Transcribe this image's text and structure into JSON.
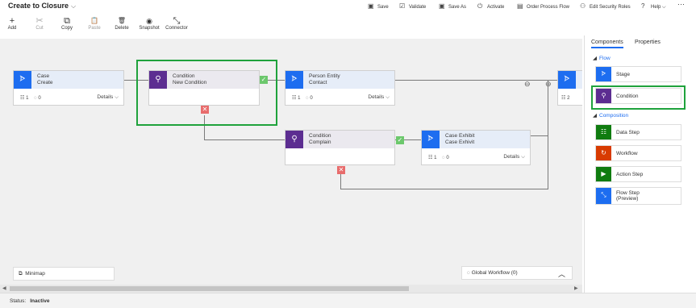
{
  "header": {
    "title": "Create to Closure"
  },
  "toolbar": [
    {
      "label": "Add",
      "icon": "plus-icon",
      "glyph": "+",
      "disabled": false
    },
    {
      "label": "Cut",
      "icon": "scissors-icon",
      "glyph": "✂",
      "disabled": true
    },
    {
      "label": "Copy",
      "icon": "copy-icon",
      "glyph": "⧉",
      "disabled": false
    },
    {
      "label": "Paste",
      "icon": "clipboard-icon",
      "glyph": "📋",
      "disabled": true
    },
    {
      "label": "Delete",
      "icon": "trash-icon",
      "glyph": "🗑",
      "disabled": false
    },
    {
      "label": "Snapshot",
      "icon": "camera-icon",
      "glyph": "◉",
      "disabled": false
    },
    {
      "label": "Connector",
      "icon": "connector-icon",
      "glyph": "⤡",
      "disabled": false
    }
  ],
  "commands": [
    {
      "label": "Save",
      "icon": "save-icon",
      "glyph": "💾"
    },
    {
      "label": "Validate",
      "icon": "validate-icon",
      "glyph": "☑"
    },
    {
      "label": "Save As",
      "icon": "save-as-icon",
      "glyph": "💾"
    },
    {
      "label": "Activate",
      "icon": "activate-icon",
      "glyph": "⏻"
    },
    {
      "label": "Order Process Flow",
      "icon": "order-icon",
      "glyph": "▤"
    },
    {
      "label": "Edit Security Roles",
      "icon": "security-icon",
      "glyph": "👥"
    },
    {
      "label": "Help",
      "icon": "help-icon",
      "glyph": "?"
    },
    {
      "label": "···",
      "icon": "more-icon",
      "glyph": ""
    }
  ],
  "nodes": [
    {
      "line1": "Case",
      "line2": "Create",
      "steps": "1",
      "workflows": "0",
      "details": "Details"
    },
    {
      "line1": "Condition",
      "line2": "New Condition"
    },
    {
      "line1": "Person Entity",
      "line2": "Contact",
      "steps": "1",
      "workflows": "0",
      "details": "Details"
    },
    {
      "line1": "Condition",
      "line2": "Complain"
    },
    {
      "line1": "Case Exhibit",
      "line2": "Case Exhivit",
      "steps": "1",
      "workflows": "0",
      "details": "Details"
    },
    {
      "steps": "2"
    }
  ],
  "minimap": {
    "label": "Minimap"
  },
  "global_workflow": {
    "label": "Global Workflow (0)"
  },
  "status": {
    "label": "Status:",
    "value": "Inactive"
  },
  "side_panel": {
    "tabs": [
      {
        "label": "Components",
        "active": true
      },
      {
        "label": "Properties",
        "active": false
      }
    ],
    "sections": [
      {
        "label": "Flow"
      },
      {
        "label": "Composition"
      }
    ],
    "components": [
      {
        "label": "Stage",
        "color": "#1d6df0",
        "icon": "stage-icon"
      },
      {
        "label": "Condition",
        "color": "#5c2d91",
        "icon": "condition-icon"
      },
      {
        "label": "Data Step",
        "color": "#107c10",
        "icon": "data-step-icon"
      },
      {
        "label": "Workflow",
        "color": "#d83b01",
        "icon": "workflow-icon"
      },
      {
        "label": "Action Step",
        "color": "#107c10",
        "icon": "action-step-icon"
      },
      {
        "label": "Flow Step",
        "label2": "(Preview)",
        "color": "#1d6df0",
        "icon": "flow-step-icon"
      }
    ]
  },
  "colors": {
    "highlight": "#1fa23c",
    "stage": "#1d6df0",
    "condition": "#5c2d91",
    "success": "#6cc86c",
    "failure": "#e86c6c"
  }
}
